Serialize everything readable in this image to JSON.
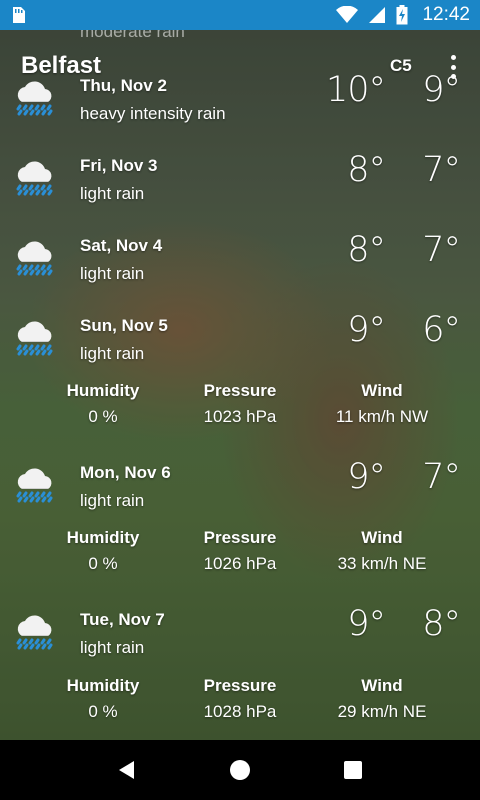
{
  "status_bar": {
    "time": "12:42",
    "icons": [
      "sd-card-icon",
      "wifi-icon",
      "signal-icon",
      "battery-charging-icon"
    ]
  },
  "header": {
    "city": "Belfast",
    "units": "C5",
    "menu_icon": "overflow-menu-icon"
  },
  "faded_row": {
    "desc": "moderate rain"
  },
  "forecast": [
    {
      "date": "Thu, Nov 2",
      "desc": "heavy intensity rain",
      "high": "10°",
      "low": "9°",
      "icon": "heavy-rain-cloud-icon"
    },
    {
      "date": "Fri, Nov 3",
      "desc": "light rain",
      "high": "8°",
      "low": "7°",
      "icon": "rain-cloud-icon"
    },
    {
      "date": "Sat, Nov 4",
      "desc": "light rain",
      "high": "8°",
      "low": "7°",
      "icon": "rain-cloud-icon"
    },
    {
      "date": "Sun, Nov 5",
      "desc": "light rain",
      "high": "9°",
      "low": "6°",
      "icon": "rain-cloud-icon",
      "details": {
        "humidity": "0 %",
        "pressure": "1023 hPa",
        "wind": "11 km/h NW"
      }
    },
    {
      "date": "Mon, Nov 6",
      "desc": "light rain",
      "high": "9°",
      "low": "7°",
      "icon": "rain-cloud-icon",
      "details": {
        "humidity": "0 %",
        "pressure": "1026 hPa",
        "wind": "33 km/h NE"
      }
    },
    {
      "date": "Tue, Nov 7",
      "desc": "light rain",
      "high": "9°",
      "low": "8°",
      "icon": "rain-cloud-icon",
      "details": {
        "humidity": "0 %",
        "pressure": "1028 hPa",
        "wind": "29 km/h NE"
      }
    }
  ],
  "detail_labels": {
    "humidity": "Humidity",
    "pressure": "Pressure",
    "wind": "Wind"
  },
  "nav": {
    "back": "back-icon",
    "home": "home-icon",
    "recents": "recents-icon"
  },
  "colors": {
    "status_bar": "#1b86c7",
    "text": "#ffffff",
    "icon_drop": "#2a8fd6"
  }
}
